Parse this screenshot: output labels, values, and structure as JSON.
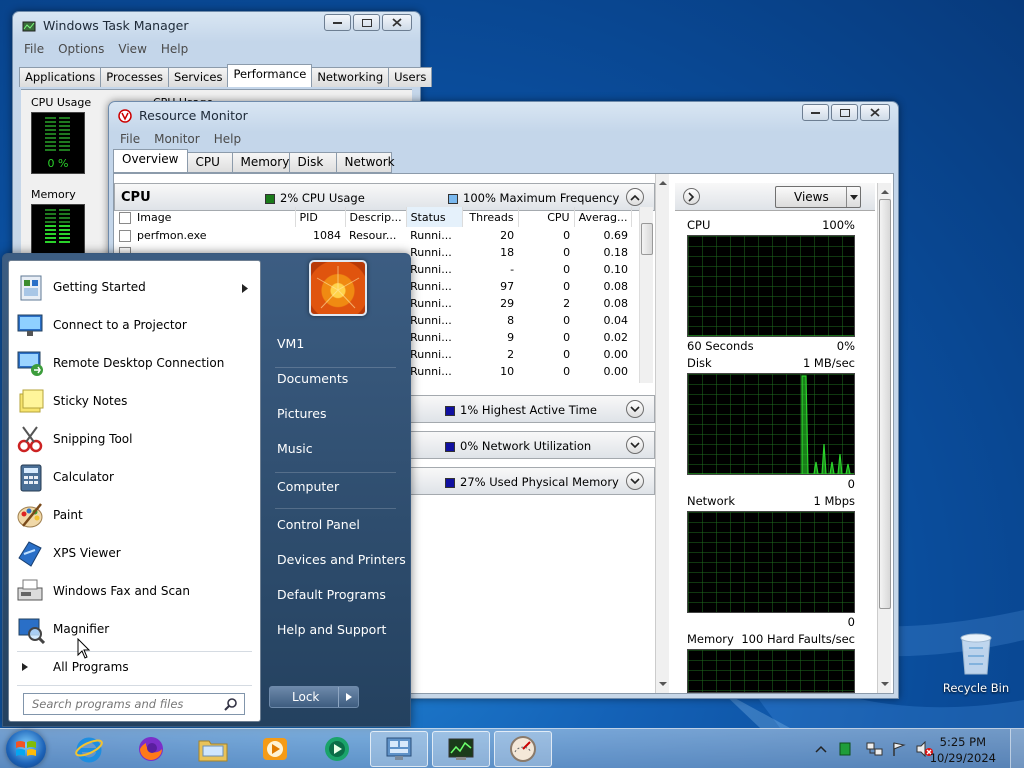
{
  "taskmgr": {
    "title": "Windows Task Manager",
    "menu": [
      "File",
      "Options",
      "View",
      "Help"
    ],
    "tabs": [
      "Applications",
      "Processes",
      "Services",
      "Performance",
      "Networking",
      "Users"
    ],
    "active_tab": "Performance",
    "cpu_usage_label": "CPU Usage",
    "cpu_usage_value": "0 %",
    "cpu_history_label": "CPU Usage History",
    "memory_label": "Memory"
  },
  "resmon": {
    "title": "Resource Monitor",
    "menu": [
      "File",
      "Monitor",
      "Help"
    ],
    "tabs": [
      "Overview",
      "CPU",
      "Memory",
      "Disk",
      "Network"
    ],
    "active_tab": "Overview",
    "cpu_section": {
      "title": "CPU",
      "usage": "2% CPU Usage",
      "frequency": "100% Maximum Frequency",
      "columns": [
        "Image",
        "PID",
        "Descrip...",
        "Status",
        "Threads",
        "CPU",
        "Averag..."
      ],
      "rows": [
        {
          "image": "perfmon.exe",
          "pid": "1084",
          "desc": "Resour...",
          "status": "Runni...",
          "threads": "20",
          "cpu": "0",
          "avg": "0.69"
        },
        {
          "image": "",
          "pid": "",
          "desc": "",
          "status": "Runni...",
          "threads": "18",
          "cpu": "0",
          "avg": "0.18"
        },
        {
          "image": "",
          "pid": "",
          "desc": "",
          "status": "Runni...",
          "threads": "-",
          "cpu": "0",
          "avg": "0.10"
        },
        {
          "image": "",
          "pid": "",
          "desc": "",
          "status": "Runni...",
          "threads": "97",
          "cpu": "0",
          "avg": "0.08"
        },
        {
          "image": "",
          "pid": "",
          "desc": "",
          "status": "Runni...",
          "threads": "29",
          "cpu": "2",
          "avg": "0.08"
        },
        {
          "image": "",
          "pid": "",
          "desc": "",
          "status": "Runni...",
          "threads": "8",
          "cpu": "0",
          "avg": "0.04"
        },
        {
          "image": "",
          "pid": "",
          "desc": "",
          "status": "Runni...",
          "threads": "9",
          "cpu": "0",
          "avg": "0.02"
        },
        {
          "image": "",
          "pid": "",
          "desc": "",
          "status": "Runni...",
          "threads": "2",
          "cpu": "0",
          "avg": "0.00"
        },
        {
          "image": "",
          "pid": "",
          "desc": "",
          "status": "Runni...",
          "threads": "10",
          "cpu": "0",
          "avg": "0.00"
        }
      ]
    },
    "disk_section": {
      "summary": "1% Highest Active Time"
    },
    "network_section": {
      "summary": "0% Network Utilization"
    },
    "memory_section": {
      "summary": "27% Used Physical Memory"
    },
    "views_button": "Views",
    "graphs": [
      {
        "name": "CPU",
        "max": "100%",
        "min_label": "60 Seconds",
        "min": "0%"
      },
      {
        "name": "Disk",
        "max": "1 MB/sec",
        "min": "0"
      },
      {
        "name": "Network",
        "max": "1 Mbps",
        "min": "0"
      },
      {
        "name": "Memory",
        "max": "100 Hard Faults/sec",
        "min": ""
      }
    ]
  },
  "start_menu": {
    "programs": [
      {
        "label": "Getting Started",
        "icon": "getting-started-icon",
        "has_submenu": true
      },
      {
        "label": "Connect to a Projector",
        "icon": "projector-icon"
      },
      {
        "label": "Remote Desktop Connection",
        "icon": "remote-desktop-icon"
      },
      {
        "label": "Sticky Notes",
        "icon": "sticky-notes-icon"
      },
      {
        "label": "Snipping Tool",
        "icon": "snipping-tool-icon"
      },
      {
        "label": "Calculator",
        "icon": "calculator-icon"
      },
      {
        "label": "Paint",
        "icon": "paint-icon"
      },
      {
        "label": "XPS Viewer",
        "icon": "xps-viewer-icon"
      },
      {
        "label": "Windows Fax and Scan",
        "icon": "fax-scan-icon"
      },
      {
        "label": "Magnifier",
        "icon": "magnifier-icon"
      }
    ],
    "all_programs": "All Programs",
    "search_placeholder": "Search programs and files",
    "user": "VM1",
    "links": [
      "VM1",
      "Documents",
      "Pictures",
      "Music",
      "Computer",
      "Control Panel",
      "Devices and Printers",
      "Default Programs",
      "Help and Support"
    ],
    "lock_label": "Lock"
  },
  "desktop": {
    "recycle_bin": "Recycle Bin"
  },
  "taskbar": {
    "time": "5:25 PM",
    "date": "10/29/2024"
  },
  "colors": {
    "graph_green": "#2bd42b",
    "grid": "#1f6e1f",
    "accent_blue": "#1461b6"
  }
}
